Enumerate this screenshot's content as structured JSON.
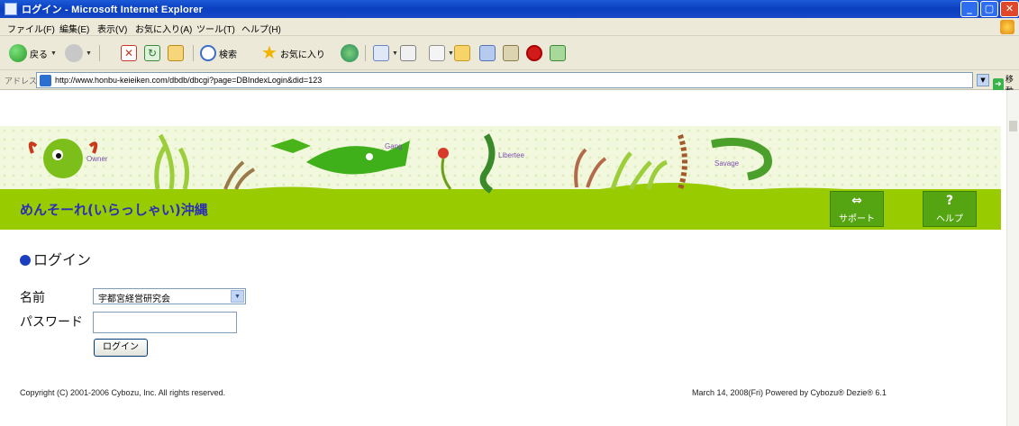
{
  "window": {
    "title": "ログイン - Microsoft Internet Explorer"
  },
  "menubar": {
    "items": [
      "ファイル(F)",
      "編集(E)",
      "表示(V)",
      "お気に入り(A)",
      "ツール(T)",
      "ヘルプ(H)"
    ]
  },
  "toolbar": {
    "back_label": "戻る",
    "search_label": "検索",
    "favorites_label": "お気に入り"
  },
  "addressbar": {
    "label": "アドレス(D)",
    "url": "http://www.honbu-keieiken.com/dbdb/dbcgi?page=DBIndexLogin&did=123",
    "go_label": "移動"
  },
  "banner": {
    "site_title": "めんそーれ(いらっしゃい)沖縄",
    "creature_labels": [
      "Owner",
      "Gang",
      "Libertee",
      "Savage"
    ],
    "support_label": "サポート",
    "help_label": "ヘルプ",
    "help_glyph": "?"
  },
  "main": {
    "section_title": "ログイン",
    "name_label": "名前",
    "name_value": "宇都宮経営研究会",
    "password_label": "パスワード",
    "login_button": "ログイン"
  },
  "footer": {
    "copyright": "Copyright (C) 2001-2006 Cybozu, Inc. All rights reserved.",
    "right": "March 14, 2008(Fri)   Powered by Cybozu® Dezie® 6.1"
  },
  "colors": {
    "banner_green": "#99cc00",
    "title_blue": "#2a2fb4",
    "button_green": "#55a512"
  }
}
